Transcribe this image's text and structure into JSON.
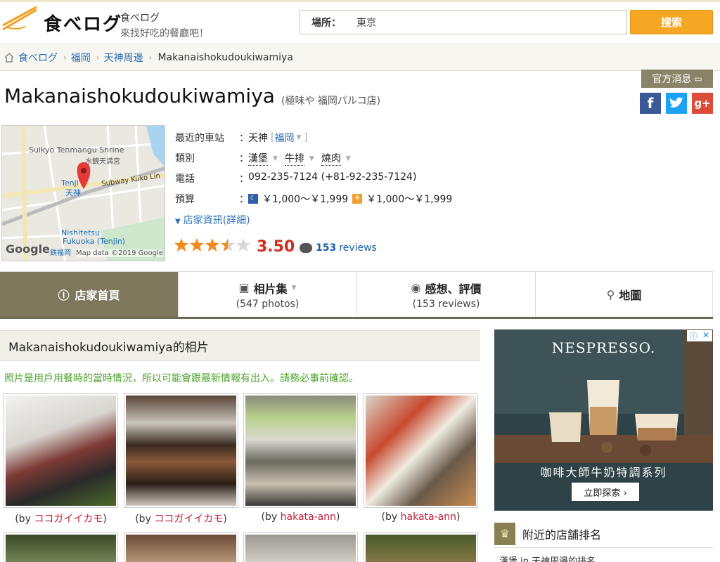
{
  "header": {
    "logo": "食べログ",
    "tagline_1": "食べログ",
    "tagline_2": "來找好吃的餐廳吧！",
    "search_label": "場所：",
    "search_value": "東京",
    "search_button": "搜索"
  },
  "breadcrumb": {
    "items": [
      "食べログ",
      "福岡",
      "天神周邊"
    ],
    "current": "Makanaishokudoukiwamiya"
  },
  "restaurant": {
    "official_label": "官方消息",
    "name": "Makanaishokudoukiwamiya",
    "subtitle": "(極味や 福岡パルコ店)",
    "info": {
      "station_label": "最近的車站",
      "station": "天神",
      "station_area": "福岡",
      "genre_label": "類別",
      "genres": [
        "漢堡",
        "牛排",
        "燒肉"
      ],
      "phone_label": "電話",
      "phone": "092-235-7124 (+81-92-235-7124)",
      "budget_label": "預算",
      "budget_dinner": "￥1,000～￥1,999",
      "budget_lunch": "￥1,000～￥1,999",
      "colon": "："
    },
    "detail_link": "店家資訊(詳細)",
    "rating": 3.5,
    "rating_text": "3.50",
    "reviews_count": "153",
    "reviews_label": "reviews"
  },
  "map": {
    "labels": [
      "Suikyo Tenmangu Shrine",
      "水鏡天満宮",
      "Subway Kuko Lin",
      "Nishitetsu",
      "Fukuoka (Tenjin)",
      "Google",
      "Map data ©2019 Google",
      "Tenji",
      "天神",
      "鉄福岡"
    ]
  },
  "tabs": [
    {
      "label": "店家首頁",
      "sub": ""
    },
    {
      "label": "相片集",
      "sub": "(547 photos)"
    },
    {
      "label": "感想、評價",
      "sub": "(153 reviews)"
    },
    {
      "label": "地圖",
      "sub": ""
    }
  ],
  "photos": {
    "title": "Makanaishokudoukiwamiya的相片",
    "notice": "照片是用戶用餐時的當時情況，所以可能會跟最新情報有出入。請務必事前確認。",
    "by_prefix": "(by ",
    "by_suffix": ")",
    "authors": [
      "ココガイイカモ",
      "ココガイイカモ",
      "hakata-ann",
      "hakata-ann"
    ]
  },
  "ad": {
    "brand": "NESPRESSO.",
    "text": "咖啡大師牛奶特調系列",
    "button": "立即探索 ›"
  },
  "nearby": {
    "title": "附近的店舗排名",
    "sub": "漢堡 in 天神周邊的排名"
  },
  "colors": {
    "accent": "#f5a623",
    "tab_active": "#7e775b",
    "score": "#d12d1e",
    "link": "#2a6db5",
    "notice": "#4ba12a"
  }
}
